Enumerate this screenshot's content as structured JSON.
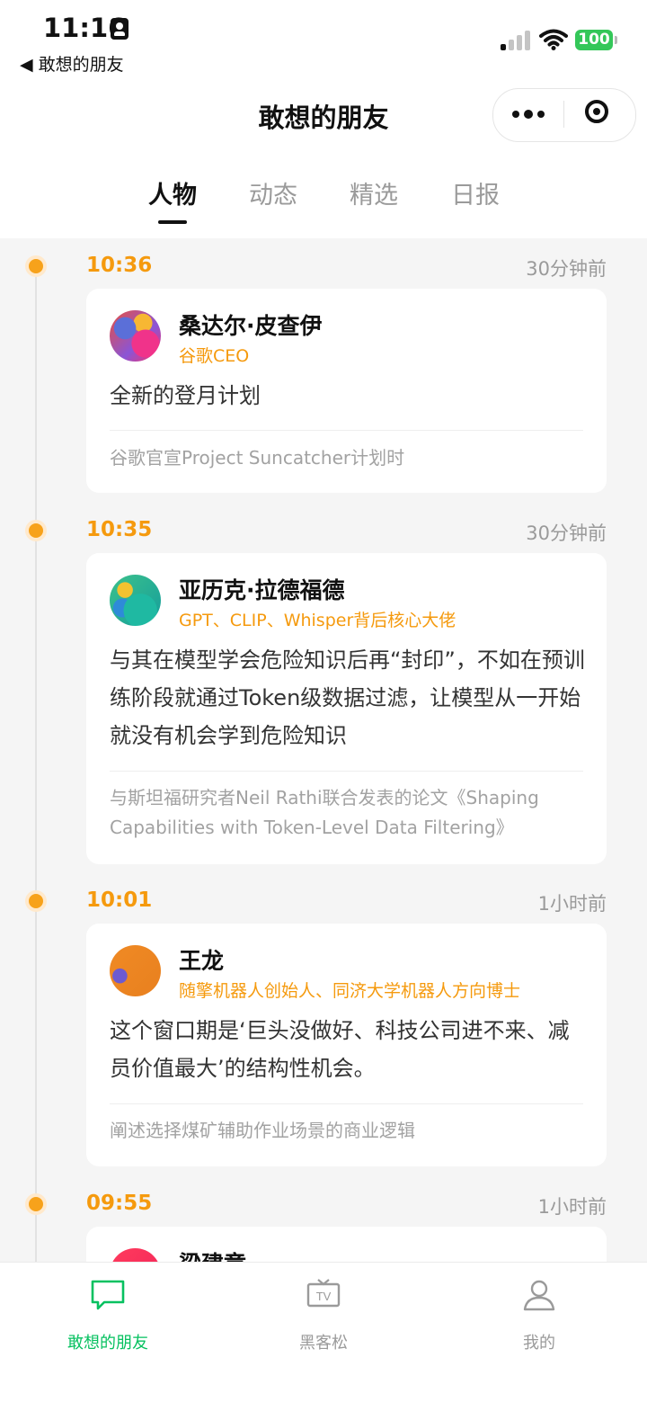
{
  "status_bar": {
    "time": "11:16",
    "back_label": "◀ 敢想的朋友",
    "battery": "100"
  },
  "nav": {
    "title": "敢想的朋友"
  },
  "tabs": [
    {
      "label": "人物"
    },
    {
      "label": "动态"
    },
    {
      "label": "精选"
    },
    {
      "label": "日报"
    }
  ],
  "feed": [
    {
      "time": "10:36",
      "ago": "30分钟前",
      "name": "桑达尔·皮查伊",
      "title": "谷歌CEO",
      "quote": "全新的登月计划",
      "source": "谷歌官宣Project Suncatcher计划时"
    },
    {
      "time": "10:35",
      "ago": "30分钟前",
      "name": "亚历克·拉德福德",
      "title": "GPT、CLIP、Whisper背后核心大佬",
      "quote": "与其在模型学会危险知识后再“封印”，不如在预训练阶段就通过Token级数据过滤，让模型从一开始就没有机会学到危险知识",
      "source": "与斯坦福研究者Neil Rathi联合发表的论文《Shaping Capabilities with Token-Level Data Filtering》"
    },
    {
      "time": "10:01",
      "ago": "1小时前",
      "name": "王龙",
      "title": "随擎机器人创始人、同济大学机器人方向博士",
      "quote": "这个窗口期是‘巨头没做好、科技公司进不来、减员价值最大’的结构性机会。",
      "source": "阐述选择煤矿辅助作业场景的商业逻辑"
    },
    {
      "time": "09:55",
      "ago": "1小时前",
      "name": "梁建章"
    }
  ],
  "bottom_nav": [
    {
      "label": "敢想的朋友"
    },
    {
      "label": "黑客松"
    },
    {
      "label": "我的"
    }
  ],
  "colors": {
    "accent": "#f59a0e",
    "brand_green": "#07c160",
    "battery_green": "#34c759"
  }
}
